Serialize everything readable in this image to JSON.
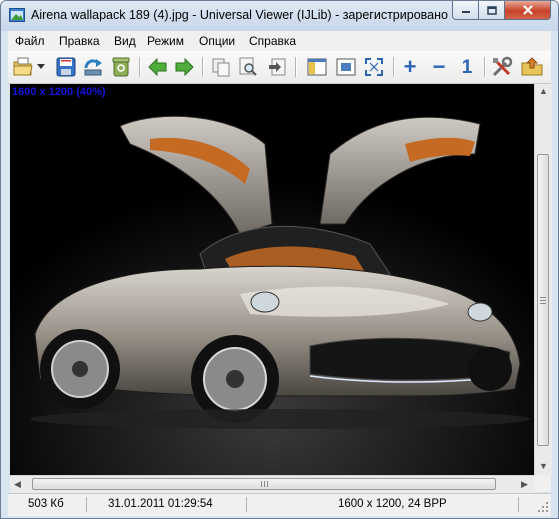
{
  "window": {
    "title": "Airena wallapack 189 (4).jpg - Universal Viewer (IJLib) - зарегистрировано",
    "app_icon": "app-icon",
    "controls": [
      "minimize-icon",
      "maximize-icon",
      "close-icon"
    ]
  },
  "menu": {
    "items": [
      "Файл",
      "Правка",
      "Вид",
      "Режим",
      "Опции",
      "Справка"
    ]
  },
  "toolbar": {
    "icons": [
      "open-folder-icon",
      "dropdown-arrow-icon",
      "save-icon",
      "reload-icon",
      "recycle-bin-icon",
      "previous-arrow-icon",
      "next-arrow-icon",
      "copy-icon",
      "find-icon",
      "export-icon",
      "panel-icon",
      "fit-window-icon",
      "fullscreen-icon",
      "zoom-in-icon",
      "zoom-out-icon",
      "actual-size-icon",
      "tools-icon",
      "folder-up-icon"
    ],
    "zoom_in_glyph": "+",
    "zoom_out_glyph": "−",
    "actual_size_glyph": "1"
  },
  "viewer": {
    "image_info": "1600 x 1200 (40%)",
    "image_subject": "silver sports car with open gull-wing doors on black background",
    "colors": {
      "info_text": "#1414e0",
      "background": "#000000"
    }
  },
  "status": {
    "file_size": "503 Кб",
    "date": "31.01.2011 01:29:54",
    "dimensions": "1600 x 1200, 24 BPP"
  }
}
